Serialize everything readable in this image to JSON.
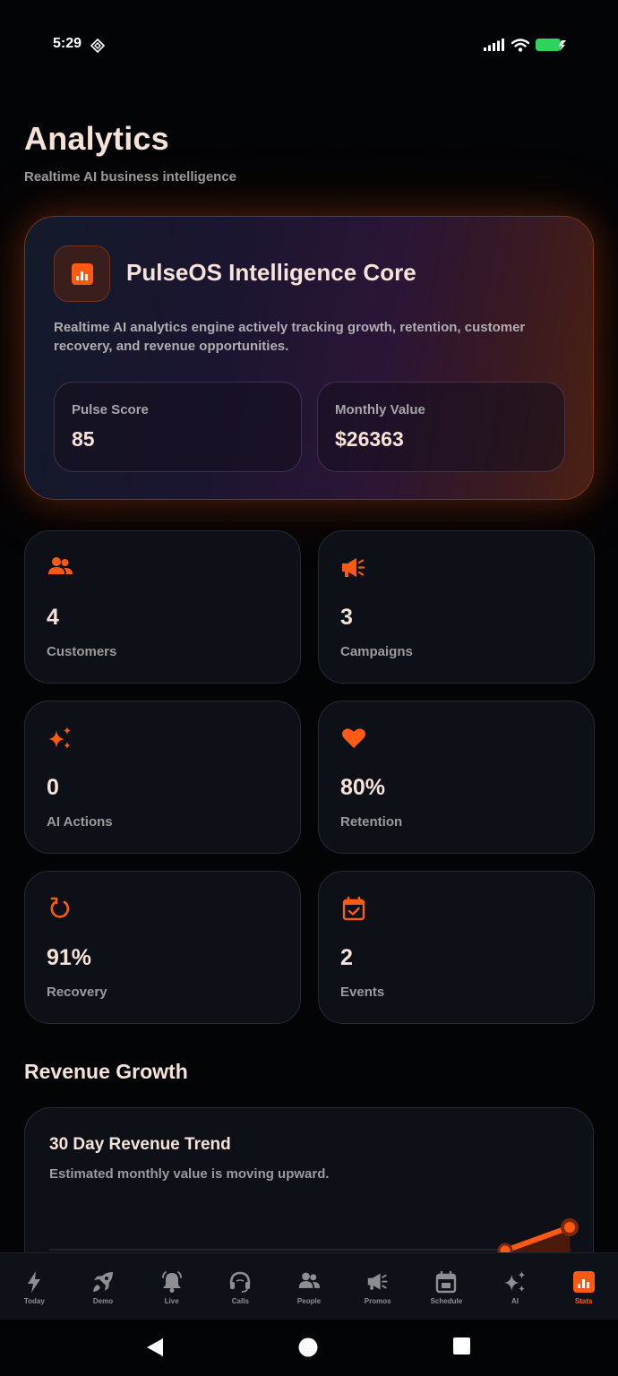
{
  "status_bar": {
    "time": "5:29"
  },
  "header": {
    "title": "Analytics",
    "subtitle": "Realtime AI business intelligence"
  },
  "hero": {
    "title": "PulseOS Intelligence Core",
    "description": "Realtime AI analytics engine actively tracking growth, retention, customer recovery, and revenue opportunities.",
    "icon": "bar-chart-icon",
    "stats": [
      {
        "label": "Pulse Score",
        "value": "85"
      },
      {
        "label": "Monthly Value",
        "value": "$26363"
      }
    ]
  },
  "metrics": [
    {
      "icon": "people-icon",
      "value": "4",
      "label": "Customers"
    },
    {
      "icon": "megaphone-icon",
      "value": "3",
      "label": "Campaigns"
    },
    {
      "icon": "sparkle-icon",
      "value": "0",
      "label": "AI Actions"
    },
    {
      "icon": "heart-icon",
      "value": "80%",
      "label": "Retention"
    },
    {
      "icon": "refresh-icon",
      "value": "91%",
      "label": "Recovery"
    },
    {
      "icon": "calendar-check-icon",
      "value": "2",
      "label": "Events"
    }
  ],
  "revenue": {
    "section_title": "Revenue Growth",
    "card_title": "30 Day Revenue Trend",
    "card_subtitle": "Estimated monthly value is moving upward."
  },
  "bottom_nav": {
    "items": [
      {
        "label": "Today",
        "icon": "bolt-icon"
      },
      {
        "label": "Demo",
        "icon": "rocket-icon"
      },
      {
        "label": "Live",
        "icon": "bell-icon"
      },
      {
        "label": "Calls",
        "icon": "headset-icon"
      },
      {
        "label": "People",
        "icon": "people-icon"
      },
      {
        "label": "Promos",
        "icon": "megaphone-icon"
      },
      {
        "label": "Schedule",
        "icon": "calendar-icon"
      },
      {
        "label": "AI",
        "icon": "sparkle-icon"
      },
      {
        "label": "Stats",
        "icon": "bar-chart-icon"
      }
    ],
    "active": "Stats"
  },
  "colors": {
    "accent": "#ff5a14",
    "background": "#030406",
    "card": "#0d1016",
    "text": "#f5e3d9",
    "muted": "#9b9b9f"
  }
}
